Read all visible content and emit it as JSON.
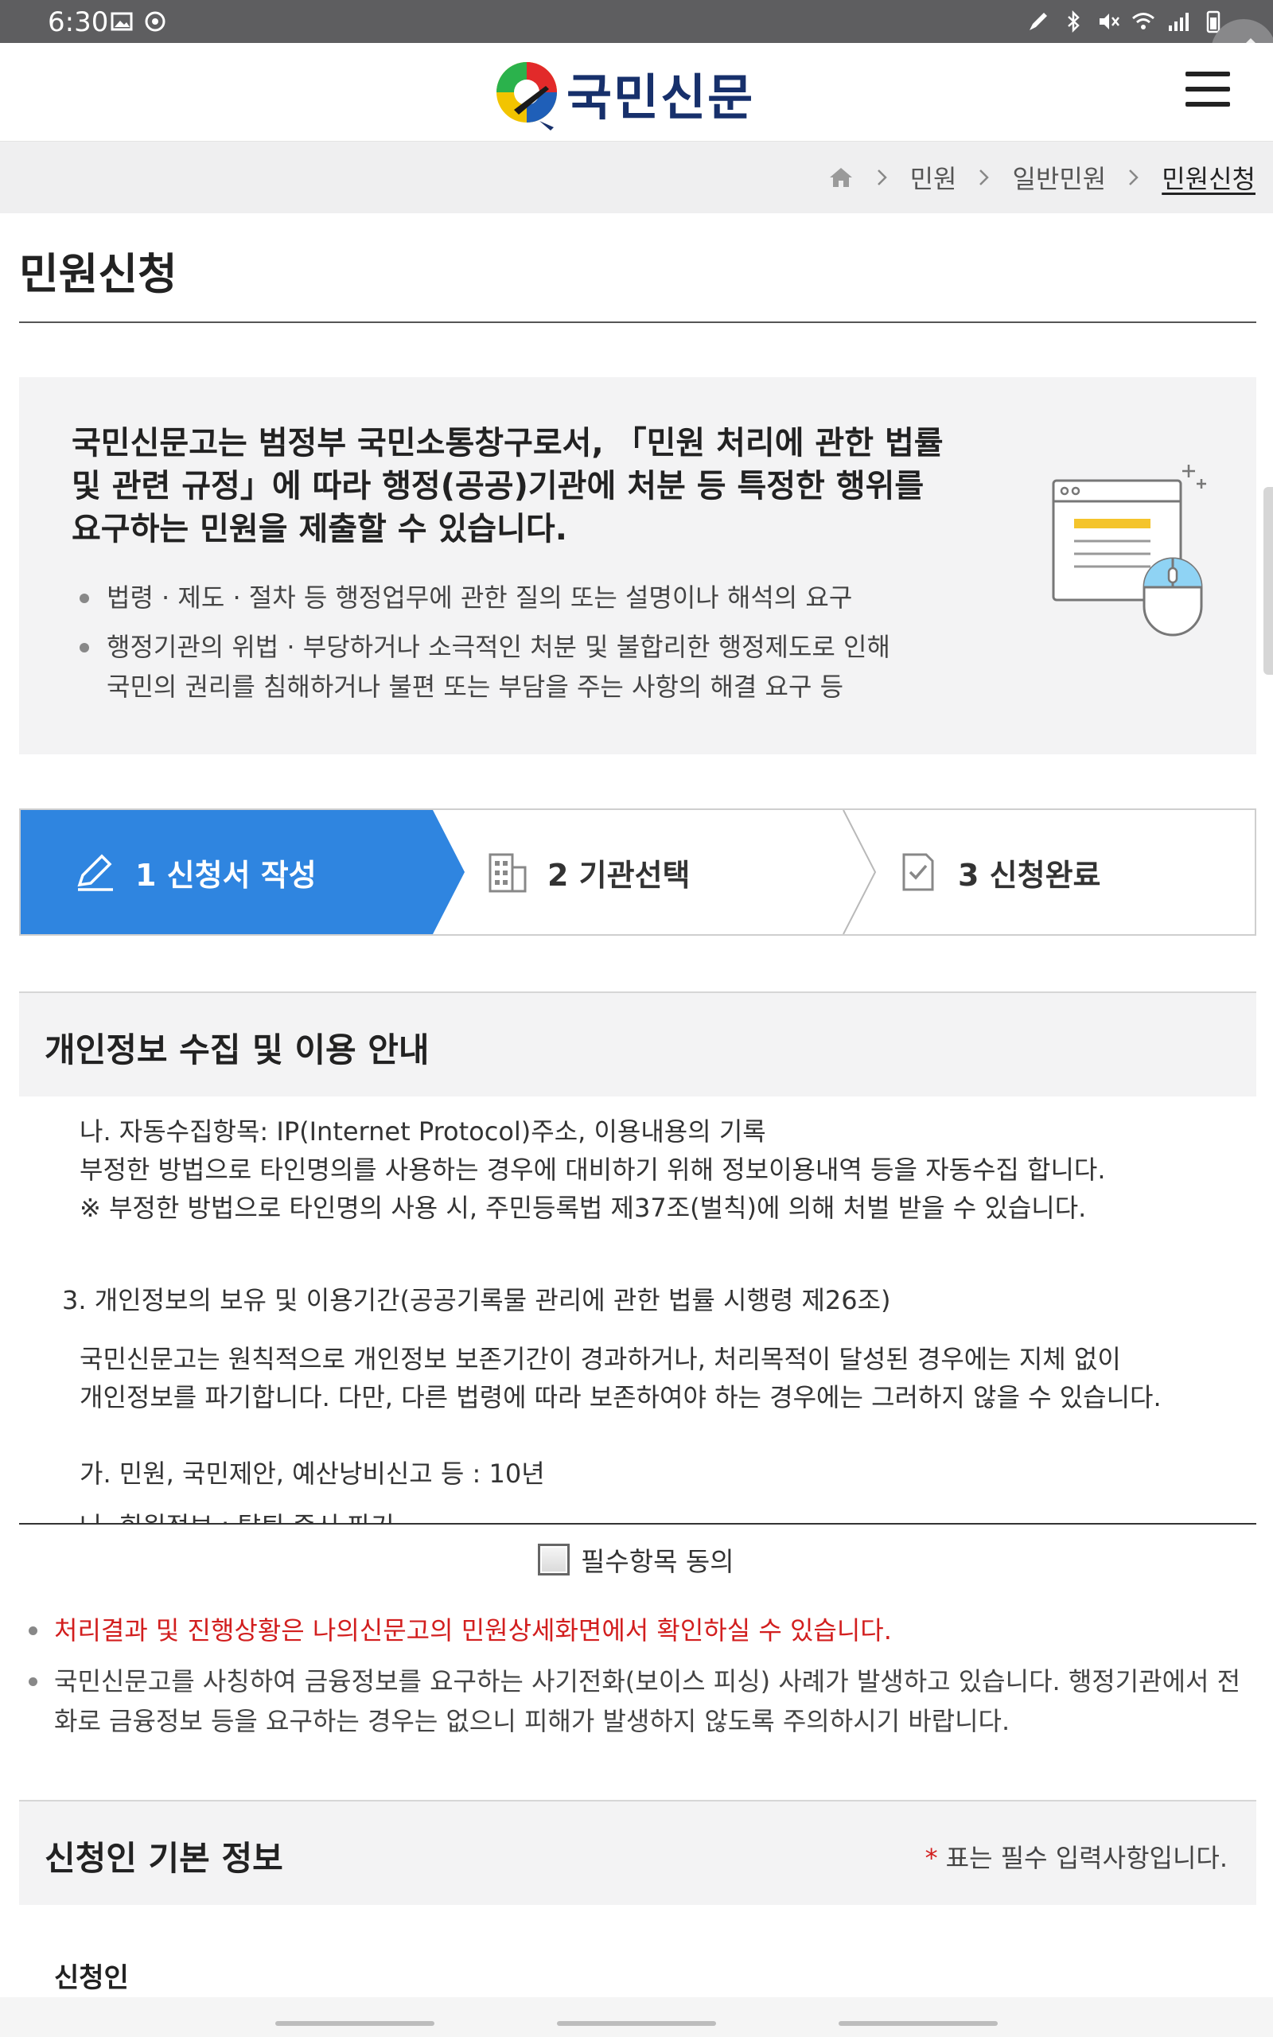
{
  "status_bar": {
    "time": "6:30"
  },
  "header": {
    "logo_text": "국민신문고"
  },
  "breadcrumb": {
    "items": [
      "민원",
      "일반민원",
      "민원신청"
    ]
  },
  "page": {
    "title": "민원신청"
  },
  "intro": {
    "heading_lines": [
      "국민신문고는 범정부 국민소통창구로서, 「민원 처리에 관한 법률",
      "및 관련 규정」에 따라 행정(공공)기관에 처분 등 특정한 행위를",
      "요구하는 민원을 제출할 수 있습니다."
    ],
    "bullets": [
      [
        "법령 · 제도 · 절차 등 행정업무에 관한 질의 또는 설명이나 해석의 요구"
      ],
      [
        "행정기관의 위법 · 부당하거나 소극적인 처분 및 불합리한 행정제도로 인해",
        "국민의 권리를 침해하거나 불편 또는 부담을 주는 사항의 해결 요구 등"
      ]
    ]
  },
  "steps": [
    {
      "label": "1 신청서 작성",
      "active": true
    },
    {
      "label": "2 기관선택",
      "active": false
    },
    {
      "label": "3 신청완료",
      "active": false
    }
  ],
  "privacy": {
    "title": "개인정보 수집 및 이용 안내",
    "lines": [
      "나. 자동수집항목: IP(Internet Protocol)주소, 이용내용의 기록",
      "부정한 방법으로 타인명의를 사용하는 경우에 대비하기 위해 정보이용내역 등을 자동수집 합니다.",
      "※ 부정한 방법으로 타인명의 사용 시, 주민등록법 제37조(벌칙)에 의해 처벌 받을 수 있습니다.",
      "3. 개인정보의 보유 및 이용기간(공공기록물 관리에 관한 법률 시행령 제26조)",
      "국민신문고는 원칙적으로 개인정보 보존기간이 경과하거나, 처리목적이 달성된 경우에는 지체 없이",
      "개인정보를 파기합니다. 다만, 다른 법령에 따라 보존하여야 하는 경우에는 그러하지 않을 수 있습니다.",
      "가. 민원, 국민제안, 예산낭비신고 등 : 10년",
      "나. 회원정보 : 탈퇴 즉시 파기"
    ]
  },
  "agree": {
    "label": "필수항목 동의",
    "checked": false
  },
  "notes": [
    {
      "text": "처리결과 및 진행상황은 나의신문고의 민원상세화면에서 확인하실 수 있습니다.",
      "highlight": true
    },
    {
      "text": "국민신문고를 사칭하여 금융정보를 요구하는 사기전화(보이스 피싱) 사례가 발생하고 있습니다. 행정기관에서 전화로 금융정보 등을 요구하는 경우는 없으니 피해가 발생하지 않도록 주의하시기 바랍니다.",
      "highlight": false
    }
  ],
  "applicant": {
    "title": "신청인 기본 정보",
    "required_note": "표는 필수 입력사항입니다.",
    "required_star": "*",
    "first_label": "신청인"
  },
  "colors": {
    "accent": "#2f85e0",
    "alert": "#d21e1e",
    "brand_navy": "#17306b"
  }
}
